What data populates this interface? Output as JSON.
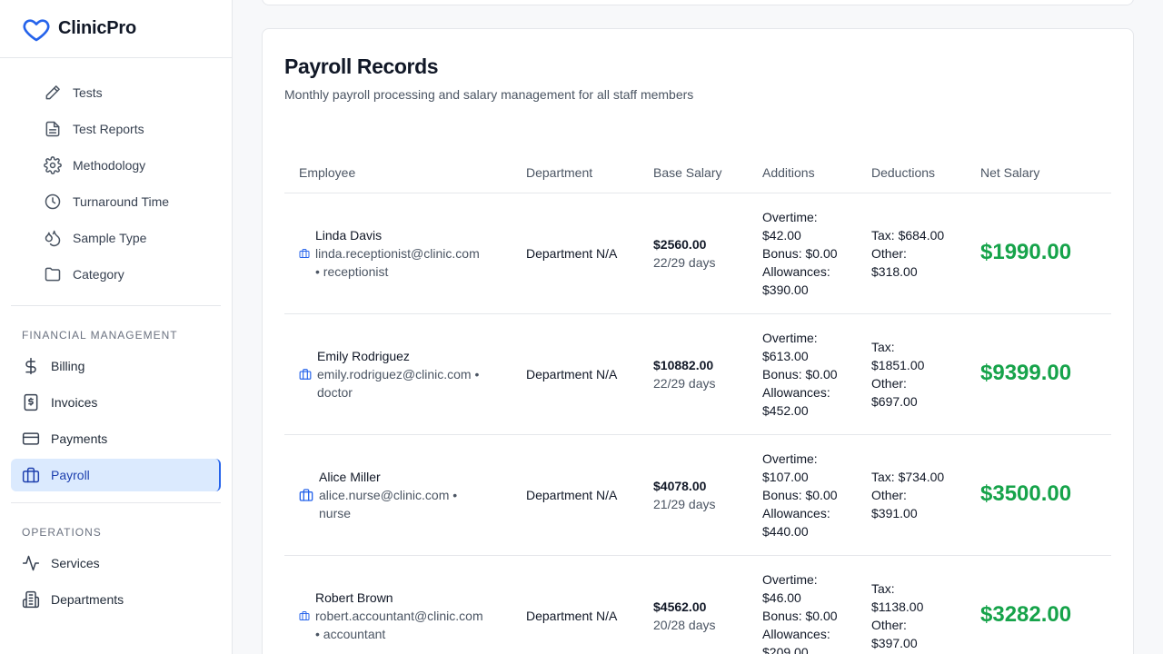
{
  "brand": {
    "name": "ClinicPro",
    "color": "#2563eb"
  },
  "sidebar": {
    "sub_items": [
      {
        "label": "Tests",
        "icon": "pencil-icon"
      },
      {
        "label": "Test Reports",
        "icon": "file-text-icon"
      },
      {
        "label": "Methodology",
        "icon": "gear-icon"
      },
      {
        "label": "Turnaround Time",
        "icon": "clock-icon"
      },
      {
        "label": "Sample Type",
        "icon": "droplets-icon"
      },
      {
        "label": "Category",
        "icon": "folder-icon"
      }
    ],
    "financial": {
      "title": "FINANCIAL MANAGEMENT",
      "items": [
        {
          "label": "Billing",
          "icon": "dollar-icon"
        },
        {
          "label": "Invoices",
          "icon": "receipt-icon"
        },
        {
          "label": "Payments",
          "icon": "credit-card-icon"
        },
        {
          "label": "Payroll",
          "icon": "briefcase-icon",
          "active": true
        }
      ]
    },
    "operations": {
      "title": "OPERATIONS",
      "items": [
        {
          "label": "Services",
          "icon": "activity-icon"
        },
        {
          "label": "Departments",
          "icon": "building-icon"
        }
      ]
    }
  },
  "payroll": {
    "title": "Payroll Records",
    "subtitle": "Monthly payroll processing and salary management for all staff members",
    "columns": [
      "Employee",
      "Department",
      "Base Salary",
      "Additions",
      "Deductions",
      "Net Salary"
    ],
    "rows": [
      {
        "name": "Linda Davis",
        "meta_line1": "linda.receptionist@clinic.com",
        "meta_line2": "• receptionist",
        "department": "Department N/A",
        "base": "$2560.00",
        "days": "22/29 days",
        "add_lines": [
          "Overtime:",
          "$42.00",
          "Bonus: $0.00",
          "Allowances:",
          "$390.00"
        ],
        "ded_lines": [
          "Tax: $684.00",
          "Other:",
          "$318.00"
        ],
        "net": "$1990.00"
      },
      {
        "name": "Emily Rodriguez",
        "meta_line1": "emily.rodriguez@clinic.com •",
        "meta_line2": "doctor",
        "department": "Department N/A",
        "base": "$10882.00",
        "days": "22/29 days",
        "add_lines": [
          "Overtime:",
          "$613.00",
          "Bonus: $0.00",
          "Allowances:",
          "$452.00"
        ],
        "ded_lines": [
          "Tax:",
          "$1851.00",
          "Other:",
          "$697.00"
        ],
        "net": "$9399.00"
      },
      {
        "name": "Alice Miller",
        "meta_line1": "alice.nurse@clinic.com •",
        "meta_line2": "nurse",
        "department": "Department N/A",
        "base": "$4078.00",
        "days": "21/29 days",
        "add_lines": [
          "Overtime:",
          "$107.00",
          "Bonus: $0.00",
          "Allowances:",
          "$440.00"
        ],
        "ded_lines": [
          "Tax: $734.00",
          "Other:",
          "$391.00"
        ],
        "net": "$3500.00"
      },
      {
        "name": "Robert Brown",
        "meta_line1": "robert.accountant@clinic.com",
        "meta_line2": "• accountant",
        "department": "Department N/A",
        "base": "$4562.00",
        "days": "20/28 days",
        "add_lines": [
          "Overtime:",
          "$46.00",
          "Bonus: $0.00",
          "Allowances:",
          "$209.00"
        ],
        "ded_lines": [
          "Tax:",
          "$1138.00",
          "Other:",
          "$397.00"
        ],
        "net": "$3282.00"
      }
    ]
  },
  "colors": {
    "accent": "#2563eb",
    "active_bg": "#dbeafe",
    "net_green": "#16a34a"
  }
}
